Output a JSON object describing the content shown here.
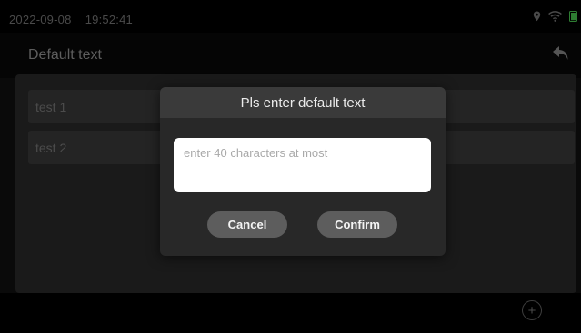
{
  "status_bar": {
    "date": "2022-09-08",
    "time": "19:52:41",
    "icons": [
      "location-icon",
      "wifi-icon",
      "battery-icon"
    ],
    "battery_color": "#2e7d32"
  },
  "header": {
    "title": "Default text",
    "back_icon": "undo-arrow-icon"
  },
  "list": {
    "items": [
      {
        "label": "test 1"
      },
      {
        "label": "test 2"
      }
    ]
  },
  "footer": {
    "add_icon": "plus-circle-icon",
    "add_symbol": "+"
  },
  "dialog": {
    "title": "Pls enter default text",
    "input": {
      "value": "",
      "placeholder": "enter 40 characters at most"
    },
    "cancel_label": "Cancel",
    "confirm_label": "Confirm"
  }
}
